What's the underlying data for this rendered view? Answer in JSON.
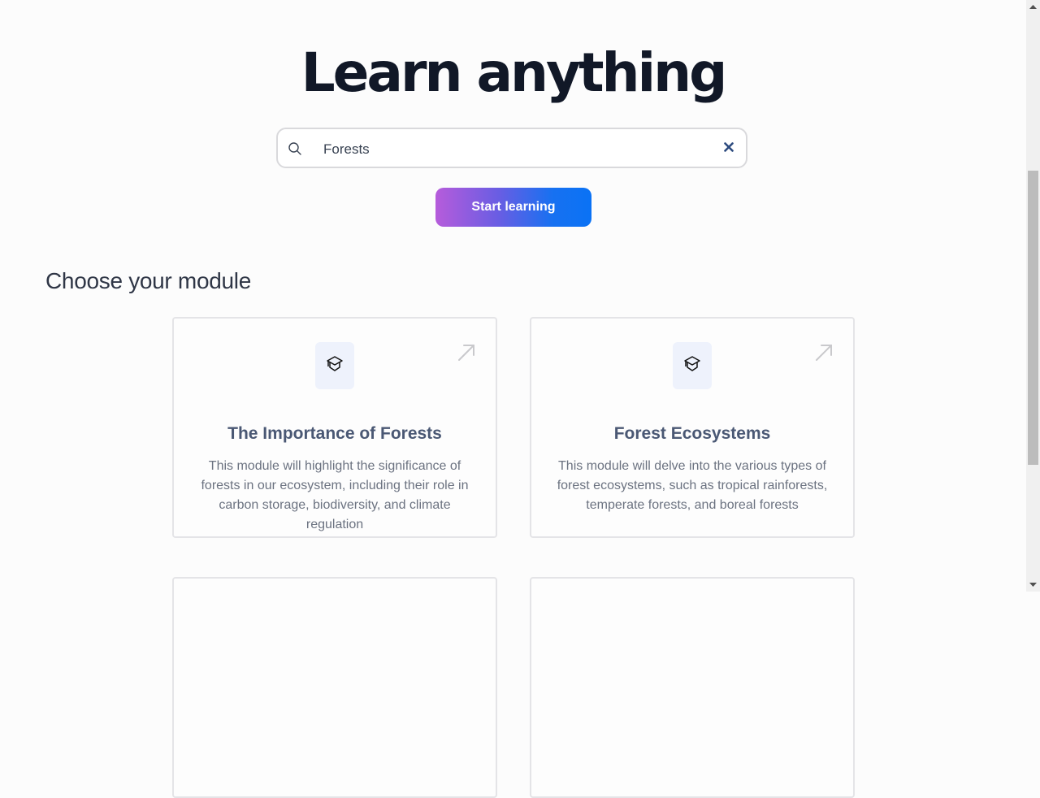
{
  "hero": {
    "title": "Learn anything"
  },
  "search": {
    "value": "Forests",
    "placeholder": "",
    "search_icon": "search-icon",
    "clear_icon": "close-icon"
  },
  "actions": {
    "start_label": "Start learning"
  },
  "modules": {
    "heading": "Choose your module",
    "items": [
      {
        "icon": "graduation-cap-icon",
        "title": "The Importance of Forests",
        "description": "This module will highlight the significance of forests in our ecosystem, including their role in carbon storage, biodiversity, and climate regulation"
      },
      {
        "icon": "graduation-cap-icon",
        "title": "Forest Ecosystems",
        "description": "This module will delve into the various types of forest ecosystems, such as tropical rainforests, temperate forests, and boreal forests"
      }
    ]
  },
  "colors": {
    "title": "#111827",
    "card_title": "#4a5874",
    "card_text": "#6b7280",
    "button_gradient_start": "#b65cdb",
    "button_gradient_end": "#0a72f5",
    "icon_bg": "#eef2fc",
    "clear_icon": "#2c4a7e"
  }
}
